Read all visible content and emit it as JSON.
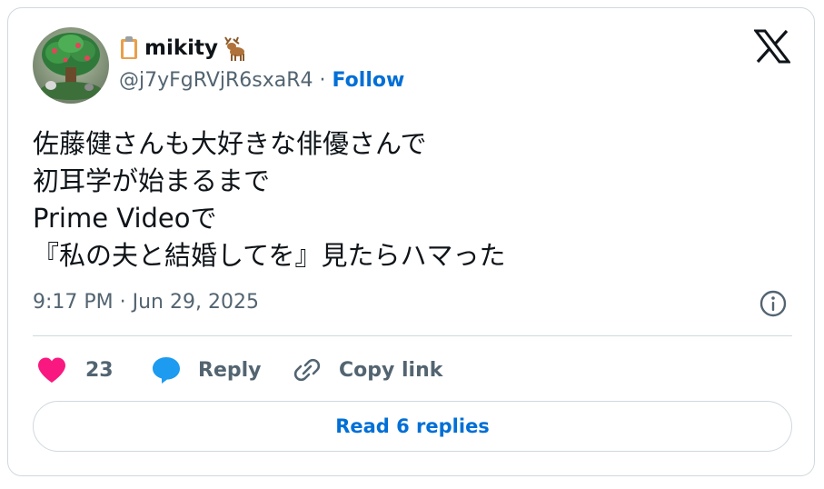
{
  "author": {
    "display_name": "mikity",
    "handle": "@j7yFgRVjR6sxaR4",
    "separator": "·",
    "follow_label": "Follow",
    "name_prefix_icon": "clipboard-emoji",
    "name_suffix_icon": "deer-emoji"
  },
  "tweet": {
    "lines": [
      "佐藤健さんも大好きな俳優さんで",
      "初耳学が始まるまで",
      "Prime Videoで",
      "『私の夫と結婚してを』見たらハマった"
    ],
    "timestamp": "9:17 PM · Jun 29, 2025"
  },
  "actions": {
    "like_count": "23",
    "reply_label": "Reply",
    "copy_link_label": "Copy link",
    "read_replies_label": "Read 6 replies"
  },
  "colors": {
    "like": "#f91880",
    "reply": "#1d9bf0",
    "link": "#006fd6",
    "secondary_text": "#536471",
    "border": "#cfd9de"
  }
}
